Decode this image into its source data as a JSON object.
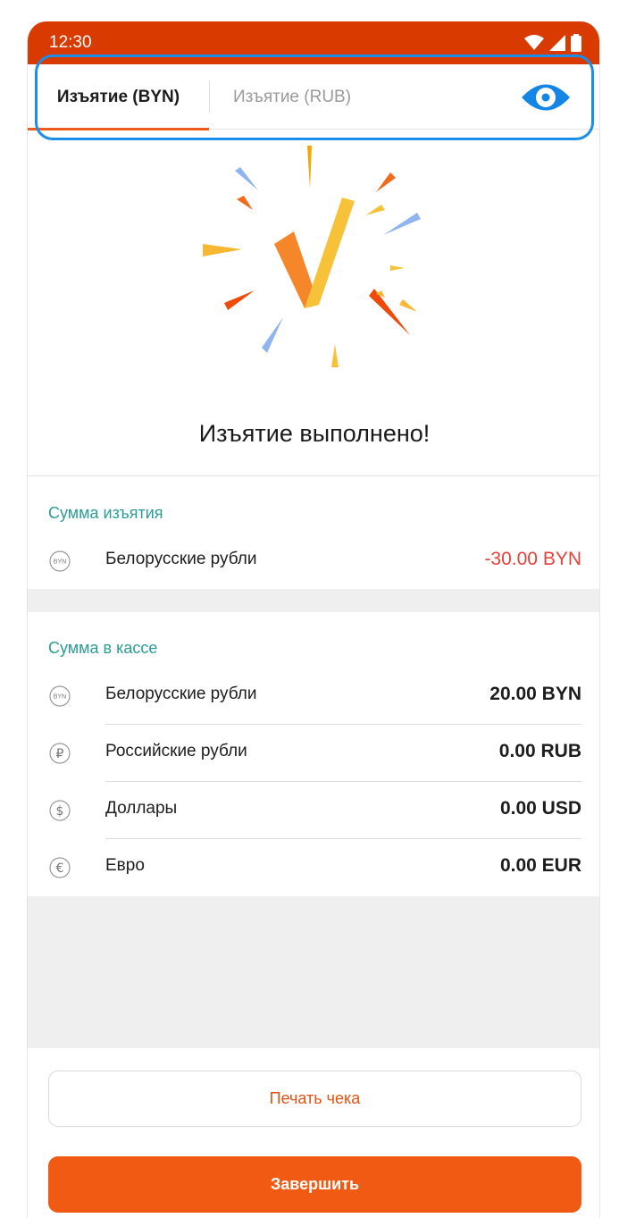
{
  "status_bar": {
    "time": "12:30",
    "icons": [
      "wifi-icon",
      "signal-icon",
      "battery-icon"
    ]
  },
  "tabs": [
    {
      "label": "Изъятие (BYN)",
      "active": true
    },
    {
      "label": "Изъятие (RUB)",
      "active": false
    }
  ],
  "view_icon": "eye-icon",
  "success": {
    "title": "Изъятие выполнено!",
    "icon": "checkmark-burst-icon"
  },
  "withdrawal": {
    "header": "Сумма изъятия",
    "rows": [
      {
        "icon": "BYN",
        "label": "Белорусские рубли",
        "amount": "-30.00 BYN"
      }
    ]
  },
  "cash": {
    "header": "Сумма в кассе",
    "rows": [
      {
        "icon": "BYN",
        "label": "Белорусские рубли",
        "amount": "20.00 BYN"
      },
      {
        "icon": "₽",
        "label": "Российские рубли",
        "amount": "0.00 RUB"
      },
      {
        "icon": "$",
        "label": "Доллары",
        "amount": "0.00 USD"
      },
      {
        "icon": "€",
        "label": "Евро",
        "amount": "0.00 EUR"
      }
    ]
  },
  "buttons": {
    "print": "Печать чека",
    "finish": "Завершить"
  },
  "colors": {
    "status_bar": "#d93a00",
    "accent": "#f05a12",
    "section_header": "#2b9c96",
    "negative": "#e8413c",
    "highlight": "#1a8ee8"
  }
}
